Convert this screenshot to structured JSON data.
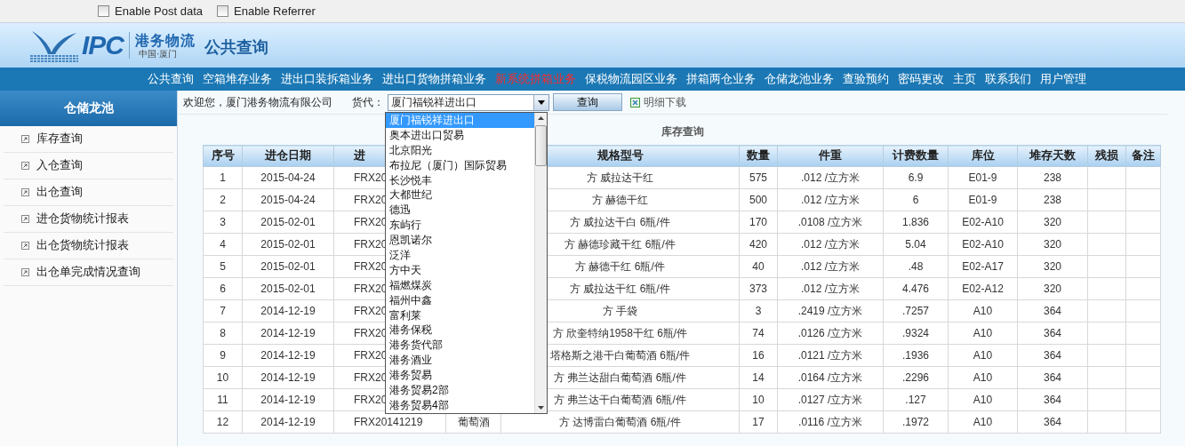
{
  "browser_toolbar": {
    "checkboxes": [
      {
        "label": "Enable Post data",
        "checked": false
      },
      {
        "label": "Enable Referrer",
        "checked": false
      }
    ]
  },
  "header": {
    "logo": {
      "mark": "IPC",
      "name": "港务物流",
      "place": "中国·厦门"
    },
    "title": "公共查询"
  },
  "nav": [
    {
      "label": "公共查询",
      "highlighted": false
    },
    {
      "label": "空箱堆存业务",
      "highlighted": false
    },
    {
      "label": "进出口装拆箱业务",
      "highlighted": false
    },
    {
      "label": "进出口货物拼箱业务",
      "highlighted": false
    },
    {
      "label": "新系统拼箱业务",
      "highlighted": true
    },
    {
      "label": "保税物流园区业务",
      "highlighted": false
    },
    {
      "label": "拼箱两仓业务",
      "highlighted": false
    },
    {
      "label": "仓储龙池业务",
      "highlighted": false
    },
    {
      "label": "查验预约",
      "highlighted": false
    },
    {
      "label": "密码更改",
      "highlighted": false
    },
    {
      "label": "主页",
      "highlighted": false
    },
    {
      "label": "联系我们",
      "highlighted": false
    },
    {
      "label": "用户管理",
      "highlighted": false
    }
  ],
  "sidebar": {
    "title": "仓储龙池",
    "items": [
      "库存查询",
      "入仓查询",
      "出仓查询",
      "进仓货物统计报表",
      "出仓货物统计报表",
      "出仓单完成情况查询"
    ]
  },
  "toolbar": {
    "welcome": "欢迎您，厦门港务物流有限公司",
    "agent_label": "货代：",
    "agent_value": "厦门福锐祥进出口",
    "query_button": "查询",
    "download_link": "明细下载"
  },
  "dropdown": {
    "options": [
      {
        "label": "厦门福锐祥进出口",
        "selected": true
      },
      {
        "label": "奥本进出口贸易",
        "selected": false
      },
      {
        "label": "北京阳光",
        "selected": false
      },
      {
        "label": "布拉尼（厦门）国际贸易",
        "selected": false
      },
      {
        "label": "长沙悦丰",
        "selected": false
      },
      {
        "label": "大都世纪",
        "selected": false
      },
      {
        "label": "德迅",
        "selected": false
      },
      {
        "label": "东屿行",
        "selected": false
      },
      {
        "label": "恩凯诺尔",
        "selected": false
      },
      {
        "label": "泛洋",
        "selected": false
      },
      {
        "label": "方中天",
        "selected": false
      },
      {
        "label": "福燃煤炭",
        "selected": false
      },
      {
        "label": "福州中鑫",
        "selected": false
      },
      {
        "label": "富利莱",
        "selected": false
      },
      {
        "label": "港务保税",
        "selected": false
      },
      {
        "label": "港务货代部",
        "selected": false
      },
      {
        "label": "港务酒业",
        "selected": false
      },
      {
        "label": "港务贸易",
        "selected": false
      },
      {
        "label": "港务贸易2部",
        "selected": false
      },
      {
        "label": "港务贸易4部",
        "selected": false
      }
    ]
  },
  "table": {
    "caption": "库存查询",
    "columns": [
      "序号",
      "进仓日期",
      "进",
      null,
      "规格型号",
      "数量",
      "件重",
      "计费数量",
      "库位",
      "堆存天数",
      "残损",
      "备注"
    ],
    "rows": [
      [
        "1",
        "2015-04-24",
        "FRX20",
        null,
        "方 威拉达干红",
        "575",
        ".012 /立方米",
        "6.9",
        "E01-9",
        "238",
        null,
        null
      ],
      [
        "2",
        "2015-04-24",
        "FRX20",
        null,
        "方 赫德干红",
        "500",
        ".012 /立方米",
        "6",
        "E01-9",
        "238",
        null,
        null
      ],
      [
        "3",
        "2015-02-01",
        "FRX20",
        null,
        "方 威拉达干白 6瓶/件",
        "170",
        ".0108 /立方米",
        "1.836",
        "E02-A10",
        "320",
        null,
        null
      ],
      [
        "4",
        "2015-02-01",
        "FRX20",
        null,
        "方 赫德珍藏干红 6瓶/件",
        "420",
        ".012 /立方米",
        "5.04",
        "E02-A10",
        "320",
        null,
        null
      ],
      [
        "5",
        "2015-02-01",
        "FRX20",
        null,
        "方 赫德干红 6瓶/件",
        "40",
        ".012 /立方米",
        ".48",
        "E02-A17",
        "320",
        null,
        null
      ],
      [
        "6",
        "2015-02-01",
        "FRX20",
        null,
        "方 威拉达干红 6瓶/件",
        "373",
        ".012 /立方米",
        "4.476",
        "E02-A12",
        "320",
        null,
        null
      ],
      [
        "7",
        "2014-12-19",
        "FRX20",
        null,
        "方 手袋",
        "3",
        ".2419 /立方米",
        ".7257",
        "A10",
        "364",
        null,
        null
      ],
      [
        "8",
        "2014-12-19",
        "FRX20",
        null,
        "方 欣奎特纳1958干红 6瓶/件",
        "74",
        ".0126 /立方米",
        ".9324",
        "A10",
        "364",
        null,
        null
      ],
      [
        "9",
        "2014-12-19",
        "FRX20",
        null,
        "塔格斯之港干白葡萄酒 6瓶/件",
        "16",
        ".0121 /立方米",
        ".1936",
        "A10",
        "364",
        null,
        null
      ],
      [
        "10",
        "2014-12-19",
        "FRX20",
        null,
        "方 弗兰达甜白葡萄酒 6瓶/件",
        "14",
        ".0164 /立方米",
        ".2296",
        "A10",
        "364",
        null,
        null
      ],
      [
        "11",
        "2014-12-19",
        "FRX20",
        null,
        "方 弗兰达干白葡萄酒 6瓶/件",
        "10",
        ".0127 /立方米",
        ".127",
        "A10",
        "364",
        null,
        null
      ],
      [
        "12",
        "2014-12-19",
        "FRX20141219",
        "葡萄酒",
        "方 达博雷白葡萄酒 6瓶/件",
        "17",
        ".0116 /立方米",
        ".1972",
        "A10",
        "364",
        null,
        null
      ]
    ]
  }
}
